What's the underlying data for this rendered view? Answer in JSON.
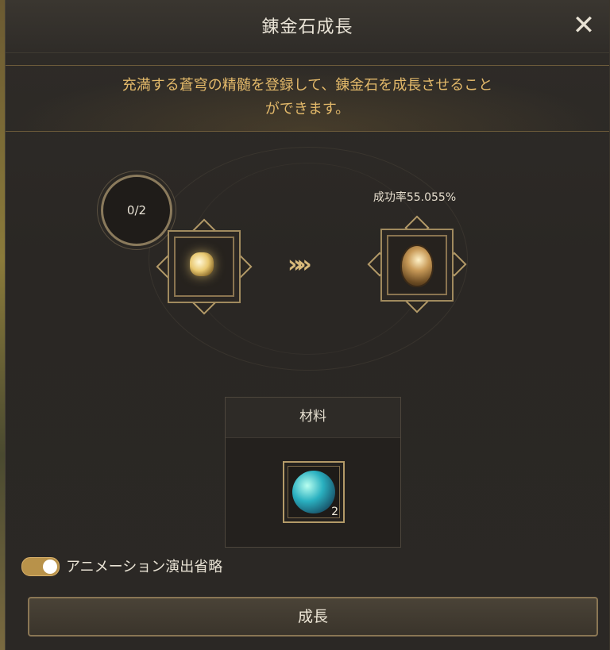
{
  "window": {
    "title": "錬金石成長",
    "close_label": "✕"
  },
  "notice": {
    "line1": "充満する蒼穹の精髄を登録して、錬金石を成長させること",
    "line2": "ができます。"
  },
  "upgrade": {
    "counter": "0/2",
    "arrows": "»»",
    "success_rate": "成功率55.055%"
  },
  "materials": {
    "header": "材料",
    "item_count": "2"
  },
  "toggle": {
    "label": "アニメーション演出省略",
    "enabled": true
  },
  "action": {
    "grow_label": "成長"
  },
  "colors": {
    "accent_gold": "#e3b96a",
    "frame_gold": "#b39a68",
    "background": "#2b2825"
  }
}
